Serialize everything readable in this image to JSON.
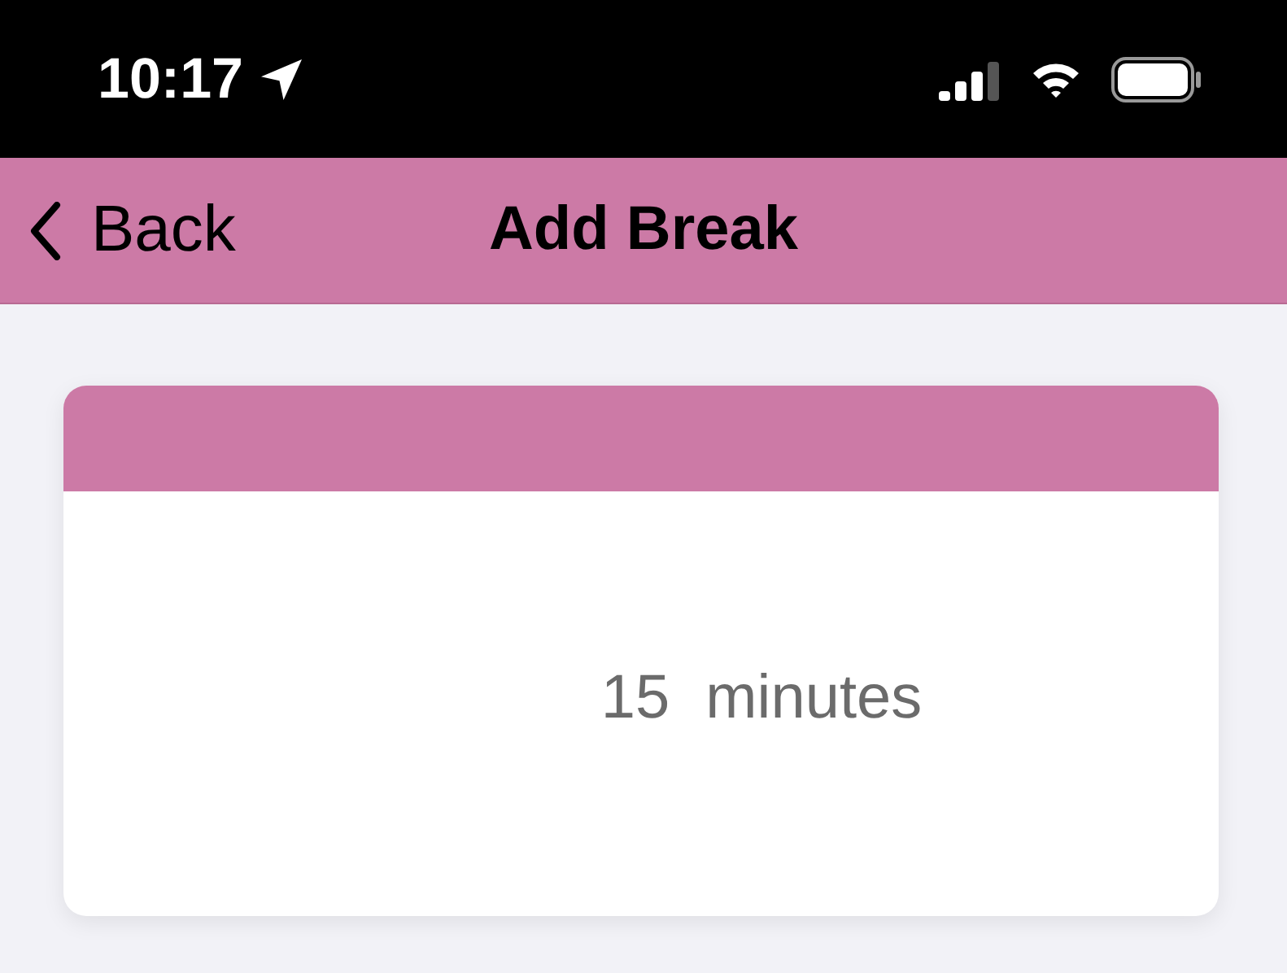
{
  "status_bar": {
    "time": "10:17"
  },
  "nav_bar": {
    "back": "Back",
    "title": "Add Break"
  },
  "card": {
    "value": "15",
    "unit": "minutes"
  }
}
